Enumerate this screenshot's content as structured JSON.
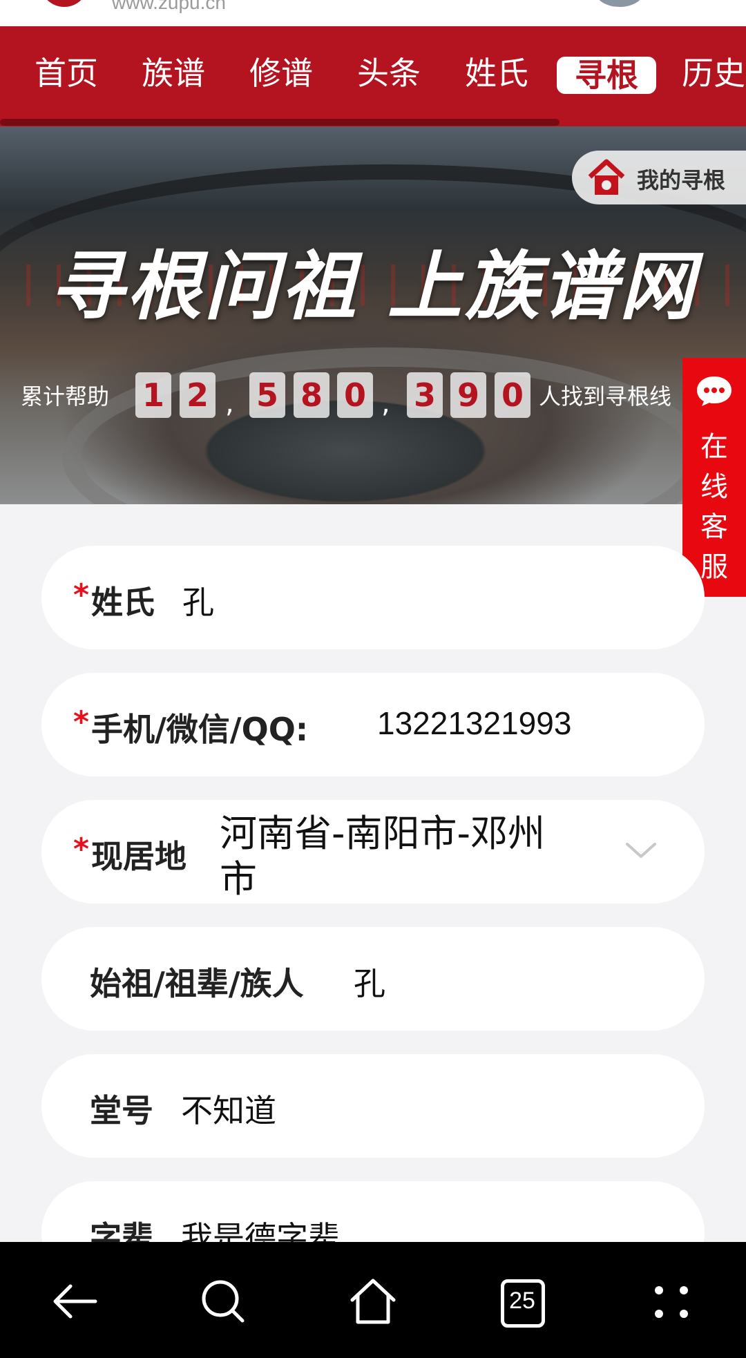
{
  "topbar": {
    "url": "www.zupu.cn"
  },
  "nav": {
    "items": [
      {
        "label": "首页"
      },
      {
        "label": "族谱"
      },
      {
        "label": "修谱"
      },
      {
        "label": "头条"
      },
      {
        "label": "姓氏"
      },
      {
        "label": "寻根"
      },
      {
        "label": "历史"
      }
    ],
    "active": "寻根"
  },
  "banner": {
    "slogan": "寻根问祖 上族谱网",
    "my_button": "我的寻根",
    "counter_prefix": "累计帮助",
    "counter_digits": [
      "1",
      "2",
      "5",
      "8",
      "0",
      "3",
      "9",
      "0"
    ],
    "counter_suffix": "人找到寻根线"
  },
  "service": {
    "label": "在线客服"
  },
  "form": {
    "required_mark": "*",
    "surname": {
      "label": "姓氏",
      "value": "孔"
    },
    "contact": {
      "label": "手机/微信/QQ:",
      "value": "13221321993"
    },
    "residence": {
      "label": "现居地",
      "value_line1": "河南省-南阳市-邓州",
      "value_line2": "市"
    },
    "ancestor": {
      "label": "始祖/祖辈/族人",
      "value": "孔"
    },
    "hall": {
      "label": "堂号",
      "value": "不知道"
    },
    "generation": {
      "label": "字辈",
      "value": "我是德字辈"
    }
  },
  "bottombar": {
    "tab_count": "25"
  },
  "colors": {
    "brand_red": "#b3141f",
    "service_red": "#e8080f",
    "page_bg": "#f3f3f5"
  }
}
